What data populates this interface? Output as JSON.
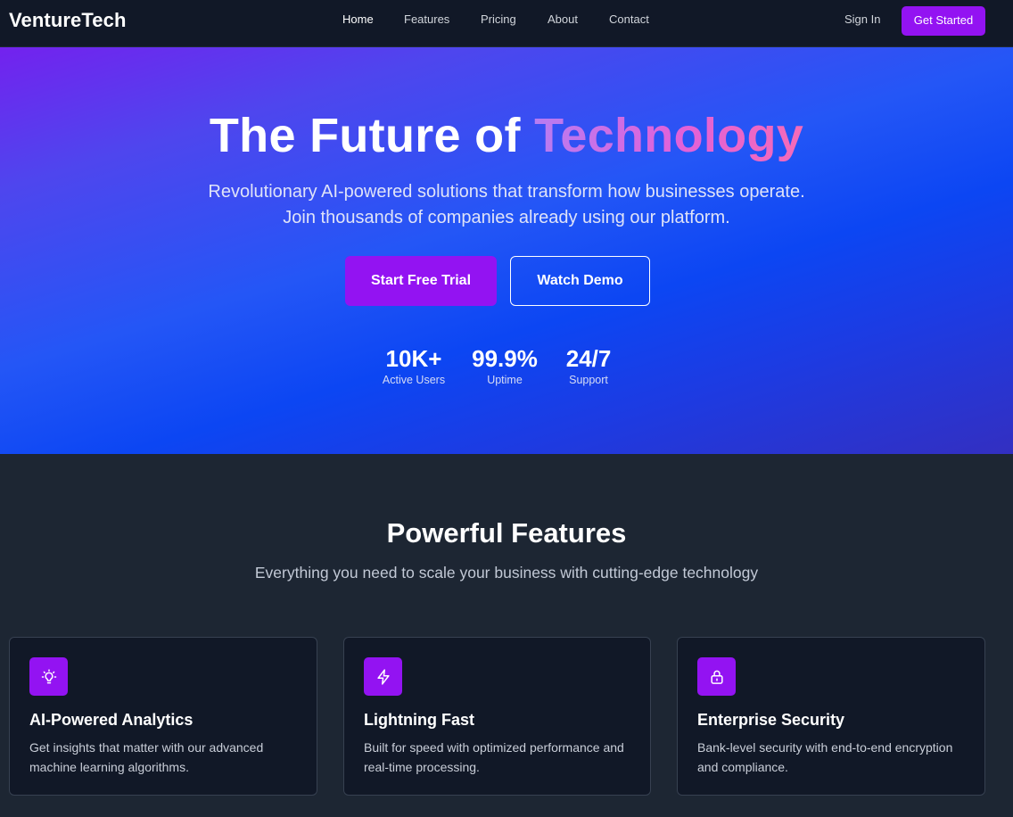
{
  "brand": {
    "name": "VentureTech",
    "accent": "#9313f2"
  },
  "nav": {
    "links": [
      {
        "label": "Home",
        "active": true
      },
      {
        "label": "Features",
        "active": false
      },
      {
        "label": "Pricing",
        "active": false
      },
      {
        "label": "About",
        "active": false
      },
      {
        "label": "Contact",
        "active": false
      }
    ],
    "sign_in": "Sign In",
    "get_started": "Get Started"
  },
  "hero": {
    "title_plain": "The Future of",
    "title_highlight": "Technology",
    "subtitle": "Revolutionary AI-powered solutions that transform how businesses operate. Join thousands of companies already using our platform.",
    "primary_cta": "Start Free Trial",
    "secondary_cta": "Watch Demo",
    "stats": [
      {
        "value": "10K+",
        "label": "Active Users"
      },
      {
        "value": "99.9%",
        "label": "Uptime"
      },
      {
        "value": "24/7",
        "label": "Support"
      }
    ]
  },
  "features": {
    "title": "Powerful Features",
    "subtitle": "Everything you need to scale your business with cutting-edge technology",
    "cards": [
      {
        "icon": "lightbulb-icon",
        "title": "AI-Powered Analytics",
        "description": "Get insights that matter with our advanced machine learning algorithms."
      },
      {
        "icon": "lightning-icon",
        "title": "Lightning Fast",
        "description": "Built for speed with optimized performance and real-time processing."
      },
      {
        "icon": "lock-icon",
        "title": "Enterprise Security",
        "description": "Bank-level security with end-to-end encryption and compliance."
      }
    ]
  }
}
